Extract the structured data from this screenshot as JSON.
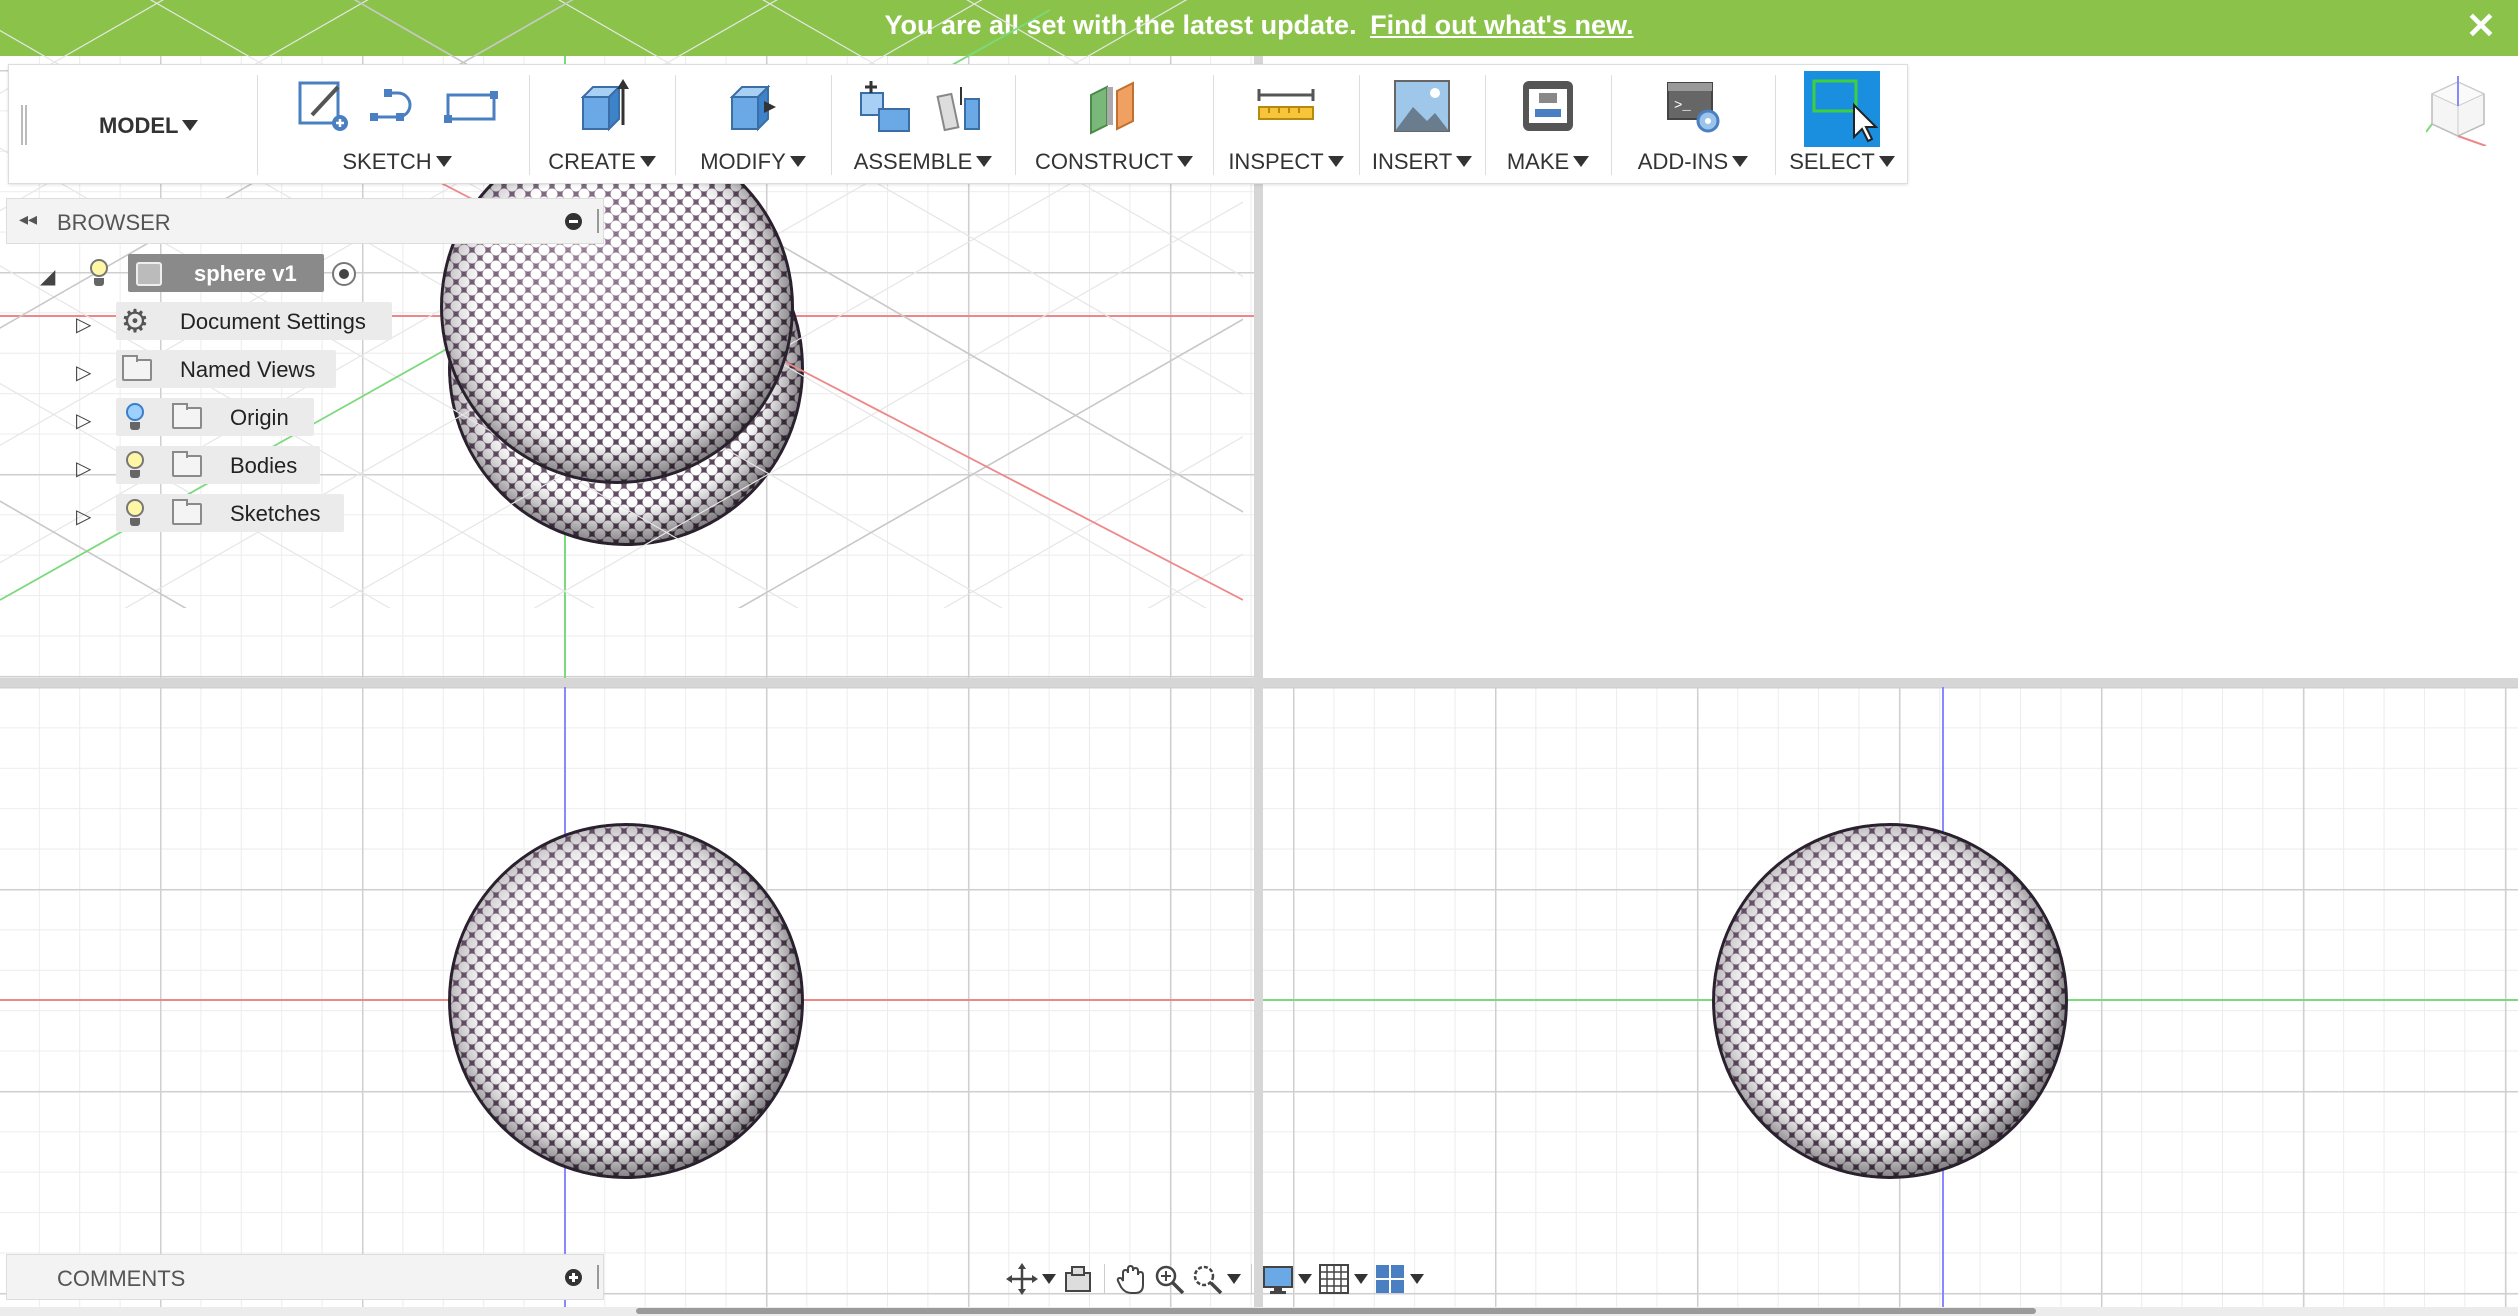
{
  "banner": {
    "message": "You are all set with the latest update.",
    "link": "Find out what's new.",
    "close_glyph": "✕",
    "color": "#8bc34a"
  },
  "toolbar": {
    "workspace": "MODEL",
    "groups": [
      {
        "label": "SKETCH",
        "icons": [
          "create-sketch-icon",
          "line-icon",
          "rectangle-icon"
        ]
      },
      {
        "label": "CREATE",
        "icons": [
          "extrude-icon"
        ]
      },
      {
        "label": "MODIFY",
        "icons": [
          "press-pull-icon"
        ]
      },
      {
        "label": "ASSEMBLE",
        "icons": [
          "new-component-icon",
          "joint-icon"
        ]
      },
      {
        "label": "CONSTRUCT",
        "icons": [
          "offset-plane-icon"
        ]
      },
      {
        "label": "INSPECT",
        "icons": [
          "measure-icon"
        ]
      },
      {
        "label": "INSERT",
        "icons": [
          "insert-image-icon"
        ]
      },
      {
        "label": "MAKE",
        "icons": [
          "3d-print-icon"
        ]
      },
      {
        "label": "ADD-INS",
        "icons": [
          "scripts-addins-icon"
        ]
      },
      {
        "label": "SELECT",
        "icons": [
          "select-icon"
        ]
      }
    ]
  },
  "browser": {
    "title": "BROWSER",
    "root": {
      "label": "sphere v1"
    },
    "items": [
      {
        "label": "Document Settings",
        "icon": "gear-icon",
        "visibility": "none"
      },
      {
        "label": "Named Views",
        "icon": "folder-icon",
        "visibility": "none"
      },
      {
        "label": "Origin",
        "icon": "folder-icon",
        "visibility": "off"
      },
      {
        "label": "Bodies",
        "icon": "folder-icon",
        "visibility": "on"
      },
      {
        "label": "Sketches",
        "icon": "folder-icon",
        "visibility": "on"
      }
    ]
  },
  "comments": {
    "title": "COMMENTS"
  },
  "navbar": {
    "items": [
      "orbit-icon",
      "look-at-icon",
      "pan-icon",
      "zoom-icon",
      "fit-icon",
      "display-settings-icon",
      "grid-settings-icon",
      "viewports-icon"
    ]
  },
  "viewports": [
    "top",
    "perspective",
    "front",
    "right"
  ],
  "colors": {
    "x_axis": "#e88888",
    "y_axis": "#7cd97c",
    "z_axis": "#8888ff",
    "active_viewport_border": "#111111",
    "select_active": "#1a8fe0"
  }
}
